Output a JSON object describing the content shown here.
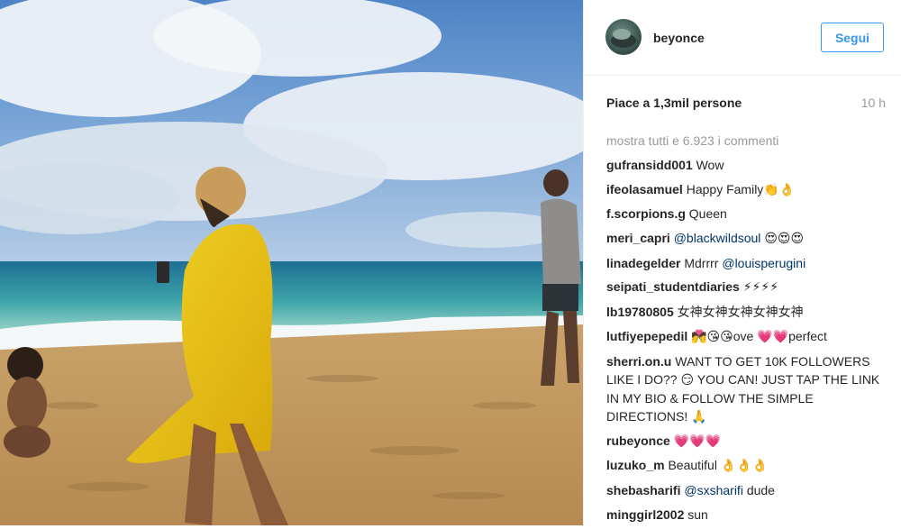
{
  "post": {
    "username": "beyonce",
    "follow_label": "Segui",
    "likes": "Piace a 1,3mil persone",
    "time": "10 h",
    "view_all": "mostra tutti e 6.923 i commenti"
  },
  "comments": [
    {
      "user": "gufransidd001",
      "text": "Wow"
    },
    {
      "user": "ifeolasamuel",
      "text": "Happy Family",
      "emoji": "👏👌"
    },
    {
      "user": "f.scorpions.g",
      "text": "Queen"
    },
    {
      "user": "meri_capri",
      "mention": "@blackwildsoul",
      "emoji": "😍😍😍"
    },
    {
      "user": "linadegelder",
      "text": "Mdrrrr",
      "mention": "@louisperugini"
    },
    {
      "user": "seipati_studentdiaries",
      "emoji": "⚡⚡⚡⚡"
    },
    {
      "user": "lb19780805",
      "text": "女神女神女神女神女神"
    },
    {
      "user": "lutfiyepepedil",
      "emoji_a": "💏😘😘",
      "text": "ove",
      "emoji_b": "💗💗",
      "text_b": "perfect"
    },
    {
      "user": "sherri.on.u",
      "text": "WANT TO GET 10K FOLLOWERS LIKE I DO??",
      "emoji": "😏",
      "text_b": "YOU CAN! JUST TAP THE LINK IN MY BIO & FOLLOW THE SIMPLE DIRECTIONS!",
      "emoji_b": "🙏"
    },
    {
      "user": "rubeyonce",
      "emoji": "💗💗💗"
    },
    {
      "user": "luzuko_m",
      "text": "Beautiful",
      "emoji": "👌👌👌"
    },
    {
      "user": "shebasharifi",
      "mention": "@sxsharifi",
      "text": "dude"
    },
    {
      "user": "minggirl2002",
      "text": "sun"
    }
  ],
  "colors": {
    "accent": "#3897f0",
    "text": "#262626",
    "muted": "#999999",
    "mention": "#003569"
  }
}
